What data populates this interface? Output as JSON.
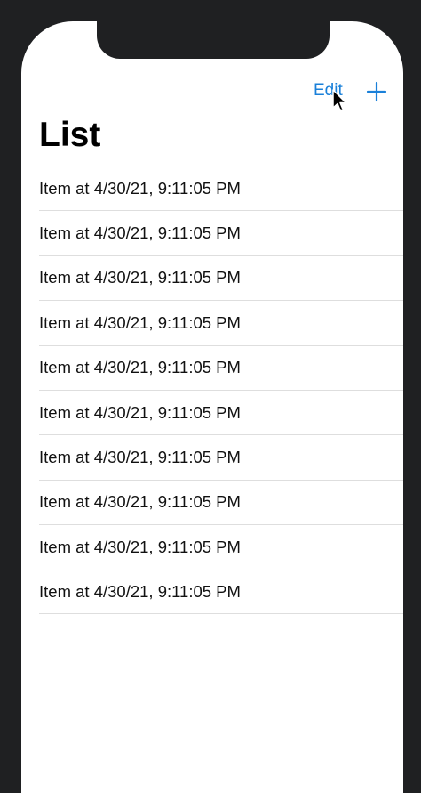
{
  "navbar": {
    "edit_label": "Edit",
    "add_icon": "plus-icon",
    "accent_color": "#1a80d9"
  },
  "title": "List",
  "items": [
    {
      "label": "Item at 4/30/21, 9:11:05 PM"
    },
    {
      "label": "Item at 4/30/21, 9:11:05 PM"
    },
    {
      "label": "Item at 4/30/21, 9:11:05 PM"
    },
    {
      "label": "Item at 4/30/21, 9:11:05 PM"
    },
    {
      "label": "Item at 4/30/21, 9:11:05 PM"
    },
    {
      "label": "Item at 4/30/21, 9:11:05 PM"
    },
    {
      "label": "Item at 4/30/21, 9:11:05 PM"
    },
    {
      "label": "Item at 4/30/21, 9:11:05 PM"
    },
    {
      "label": "Item at 4/30/21, 9:11:05 PM"
    },
    {
      "label": "Item at 4/30/21, 9:11:05 PM"
    }
  ],
  "pointer": {
    "icon": "mouse-pointer-icon"
  }
}
